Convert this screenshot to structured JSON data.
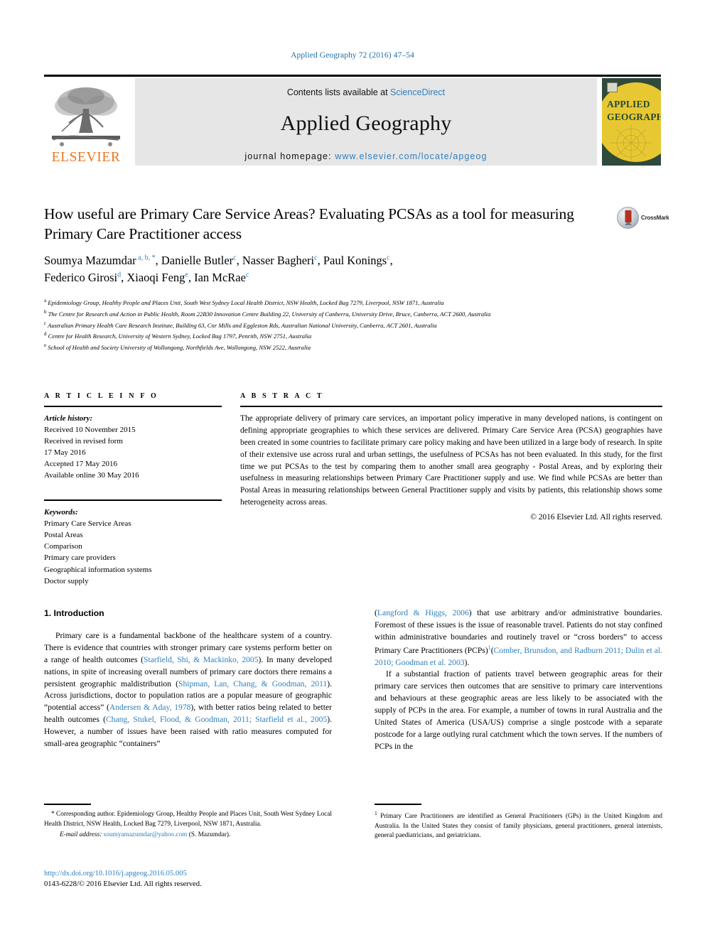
{
  "running_head": "Applied Geography 72 (2016) 47–54",
  "masthead": {
    "publisher_logo_label": "ELSEVIER",
    "contents_prefix": "Contents lists available at ",
    "contents_link": "ScienceDirect",
    "journal_name": "Applied Geography",
    "homepage_prefix": "journal homepage: ",
    "homepage_url": "www.elsevier.com/locate/apgeog",
    "cover_line1": "APPLIED",
    "cover_line2": "GEOGRAPHY"
  },
  "article": {
    "title": "How useful are Primary Care Service Areas? Evaluating PCSAs as a tool for measuring Primary Care Practitioner access",
    "crossmark_label": "CrossMark",
    "authors": [
      {
        "name": "Soumya Mazumdar",
        "marks": "a, b, *"
      },
      {
        "name": "Danielle Butler",
        "marks": "c"
      },
      {
        "name": "Nasser Bagheri",
        "marks": "c"
      },
      {
        "name": "Paul Konings",
        "marks": "c"
      },
      {
        "name": "Federico Girosi",
        "marks": "d"
      },
      {
        "name": "Xiaoqi Feng",
        "marks": "e"
      },
      {
        "name": "Ian McRae",
        "marks": "c"
      }
    ],
    "affiliations": [
      {
        "mark": "a",
        "text": "Epidemiology Group, Healthy People and Places Unit, South West Sydney Local Health District, NSW Health, Locked Bag 7279, Liverpool, NSW 1871, Australia"
      },
      {
        "mark": "b",
        "text": "The Centre for Research and Action in Public Health, Room 22B30 Innovation Centre Building 22, University of Canberra, University Drive, Bruce, Canberra, ACT 2600, Australia"
      },
      {
        "mark": "c",
        "text": "Australian Primary Health Care Research Institute, Building 63, Cnr Mills and Eggleston Rds, Australian National University, Canberra, ACT 2601, Australia"
      },
      {
        "mark": "d",
        "text": "Centre for Health Research, University of Western Sydney, Locked Bag 1797, Penrith, NSW 2751, Australia"
      },
      {
        "mark": "e",
        "text": "School of Health and Society University of Wollongong, Northfields Ave, Wollongong, NSW 2522, Australia"
      }
    ]
  },
  "info": {
    "heading": "A R T I C L E   I N F O",
    "history_label": "Article history:",
    "history_lines": [
      "Received 10 November 2015",
      "Received in revised form",
      "17 May 2016",
      "Accepted 17 May 2016",
      "Available online 30 May 2016"
    ],
    "keywords_label": "Keywords:",
    "keywords": [
      "Primary Care Service Areas",
      "Postal Areas",
      "Comparison",
      "Primary care providers",
      "Geographical information systems",
      "Doctor supply"
    ]
  },
  "abstract": {
    "heading": "A B S T R A C T",
    "text": "The appropriate delivery of primary care services, an important policy imperative in many developed nations, is contingent on defining appropriate geographies to which these services are delivered. Primary Care Service Area (PCSA) geographies have been created in some countries to facilitate primary care policy making and have been utilized in a large body of research. In spite of their extensive use across rural and urban settings, the usefulness of PCSAs has not been evaluated. In this study, for the first time we put PCSAs to the test by comparing them to another small area geography - Postal Areas, and by exploring their usefulness in measuring relationships between Primary Care Practitioner supply and use. We find while PCSAs are better than Postal Areas in measuring relationships between General Practitioner supply and visits by patients, this relationship shows some heterogeneity across areas.",
    "copyright": "© 2016 Elsevier Ltd. All rights reserved."
  },
  "body": {
    "section_title": "1.  Introduction",
    "left_paragraph_1_parts": [
      "Primary care is a fundamental backbone of the healthcare system of a country. There is evidence that countries with stronger primary care systems perform better on a range of health outcomes (",
      "Starfield, Shi, & Mackinko, 2005",
      "). In many developed nations, in spite of increasing overall numbers of primary care doctors there remains a persistent geographic maldistribution (",
      "Shipman, Lan, Chang, & Goodman, 2011",
      "). Across jurisdictions, doctor to population ratios are a popular measure of geographic “potential access” (",
      "Andersen & Aday, 1978",
      "), with better ratios being related to better health outcomes (",
      "Chang, Stukel, Flood, & Goodman, 2011; Starfield et al., 2005",
      "). However, a number of issues have been raised with ratio measures computed for small-area geographic “containers”"
    ],
    "right_paragraph_1_parts": [
      "(",
      "Langford & Higgs, 2006",
      ") that use arbitrary and/or administrative boundaries. Foremost of these issues is the issue of reasonable travel. Patients do not stay confined within administrative boundaries and routinely travel or “cross borders” to access Primary Care Practitioners (PCPs)",
      "1",
      "(",
      "Comber, Brunsdon, and Radburn 2011; Dulin et al. 2010; Goodman et al. 2003",
      ")."
    ],
    "right_paragraph_2": "If a substantial fraction of patients travel between geographic areas for their primary care services then outcomes that are sensitive to primary care interventions and behaviours at these geographic areas are less likely to be associated with the supply of PCPs in the area. For example, a number of towns in rural Australia and the United States of America (USA/US) comprise a single postcode with a separate postcode for a large outlying rural catchment which the town serves. If the numbers of PCPs in the"
  },
  "footnotes": {
    "corresponding": "* Corresponding author. Epidemiology Group, Healthy People and Places Unit, South West Sydney Local Health District, NSW Health, Locked Bag 7279, Liverpool, NSW 1871, Australia.",
    "email_label": "E-mail address:",
    "email": "soumyamazumdar@yahoo.com",
    "email_suffix": "(S. Mazumdar).",
    "footnote_1_mark": "1",
    "footnote_1": "Primary Care Practitioners are identified as General Practitioners (GPs) in the United Kingdom and Australia. In the United States they consist of family physicians, general practitioners, general internists, general paediatricians, and geriatricians.",
    "doi": "http://dx.doi.org/10.1016/j.apgeog.2016.05.005",
    "issn_line": "0143-6228/© 2016 Elsevier Ltd. All rights reserved."
  },
  "colors": {
    "link_blue": "#2e7fbd",
    "elsevier_orange": "#e87722",
    "band_grey": "#e6e6e6",
    "cover_green": "#2f4a3a",
    "cover_yellow": "#e8c832"
  }
}
